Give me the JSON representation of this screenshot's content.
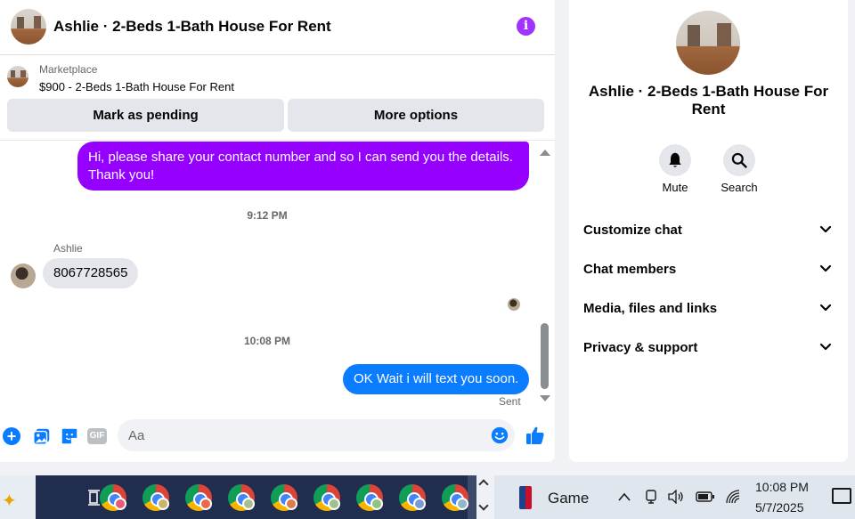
{
  "chat": {
    "header_title": "Ashlie · 2-Beds 1-Bath House For Rent",
    "marketplace_label": "Marketplace",
    "listing": "$900 - 2-Beds 1-Bath House For Rent",
    "btn_pending": "Mark as pending",
    "btn_more": "More options",
    "messages": {
      "out1": "Hi, please share your contact number and so I can send you the details. Thank you!",
      "time1": "9:12 PM",
      "sender": "Ashlie",
      "in1": "8067728565",
      "time2": "10:08 PM",
      "out2": "OK Wait i will text you soon.",
      "status": "Sent"
    },
    "composer_placeholder": "Aa",
    "gif_label": "GIF",
    "plus_glyph": "+",
    "info_glyph": "i"
  },
  "info_panel": {
    "title": "Ashlie · 2-Beds 1-Bath House For Rent",
    "actions": [
      {
        "label": "Mute",
        "icon": "bell-icon"
      },
      {
        "label": "Search",
        "icon": "search-icon"
      }
    ],
    "rows": [
      "Customize chat",
      "Chat members",
      "Media, files and links",
      "Privacy & support"
    ]
  },
  "taskbar": {
    "game_label": "Game",
    "time": "10:08 PM",
    "date": "5/7/2025"
  },
  "colors": {
    "accent_purple": "#9500ff",
    "accent_blue": "#0a7cff",
    "taskbar_dark": "#202d4f"
  }
}
